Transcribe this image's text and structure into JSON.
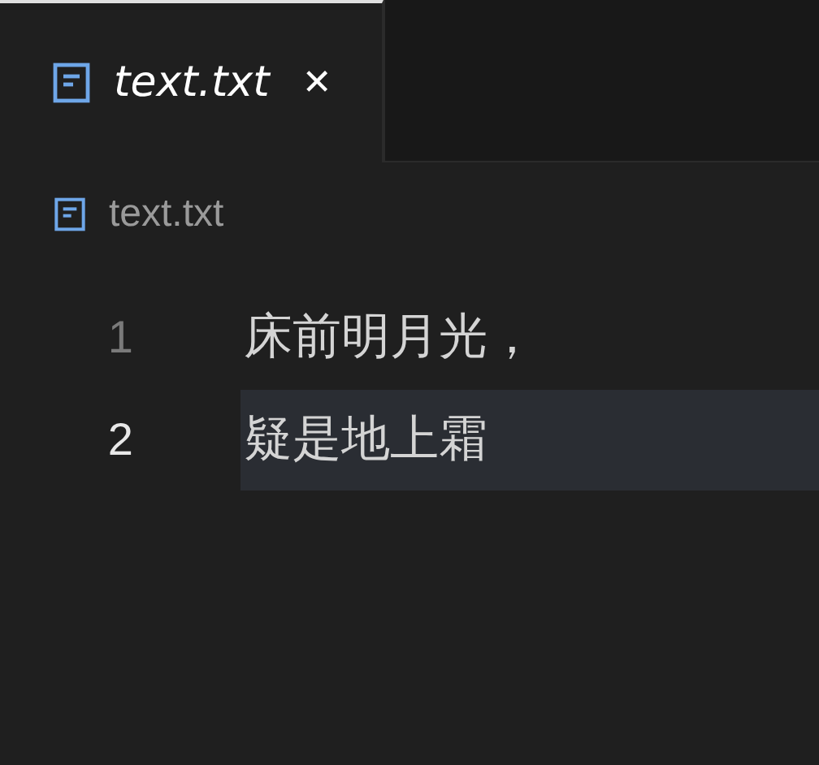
{
  "tabs": [
    {
      "label": "text.txt",
      "selected": true,
      "preview": true,
      "close": "✕"
    }
  ],
  "breadcrumb": {
    "label": "text.txt"
  },
  "lines": [
    {
      "number": "1",
      "text": "床前明月光，",
      "selected": false
    },
    {
      "number": "2",
      "text": "疑是地上霜",
      "selected": true
    }
  ]
}
